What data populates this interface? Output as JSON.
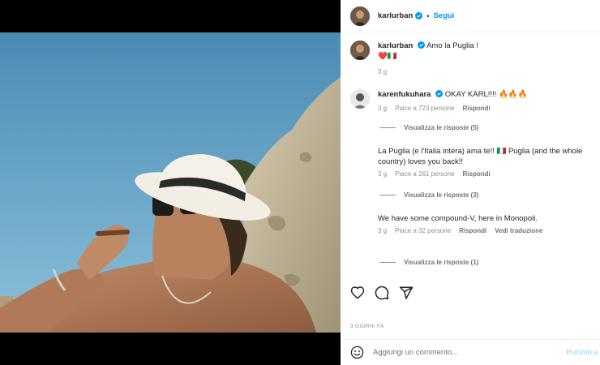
{
  "colors": {
    "accent": "#0095f6",
    "verified": "#0095f6",
    "muted": "#737373"
  },
  "post": {
    "username": "karlurban",
    "follow_label": "Segui",
    "dot": "•",
    "caption_text": "Amo la Puglia !",
    "caption_line2": "❤️🇮🇹",
    "caption_time": "3 g",
    "date": "3 GIORNI FA"
  },
  "comments": [
    {
      "username": "karenfukuhara",
      "text": "OKAY KARL!!!! 🔥🔥🔥",
      "time": "3 g",
      "likes": "Piace a 723 persone",
      "reply": "Rispondi",
      "view_replies": "Visualizza le risposte (5)"
    },
    {
      "text": "La Puglia (e l'Italia intera) ama te!! 🇮🇹 Puglia (and the whole country) loves you back!!",
      "time": "3 g",
      "likes": "Piace a 261 persone",
      "reply": "Rispondi",
      "view_replies": "Visualizza le risposte (3)"
    },
    {
      "text": "We have some compound-V, here in Monopoli.",
      "time": "3 g",
      "likes": "Piace a 32 persone",
      "reply": "Rispondi",
      "translate": "Vedi traduzione",
      "view_replies": "Visualizza le risposte (1)"
    }
  ],
  "input": {
    "placeholder": "Aggiungi un commento...",
    "publish": "Pubblica"
  },
  "icons": [
    "heart-icon",
    "comment-icon",
    "share-icon",
    "emoji-icon",
    "verified-icon"
  ]
}
